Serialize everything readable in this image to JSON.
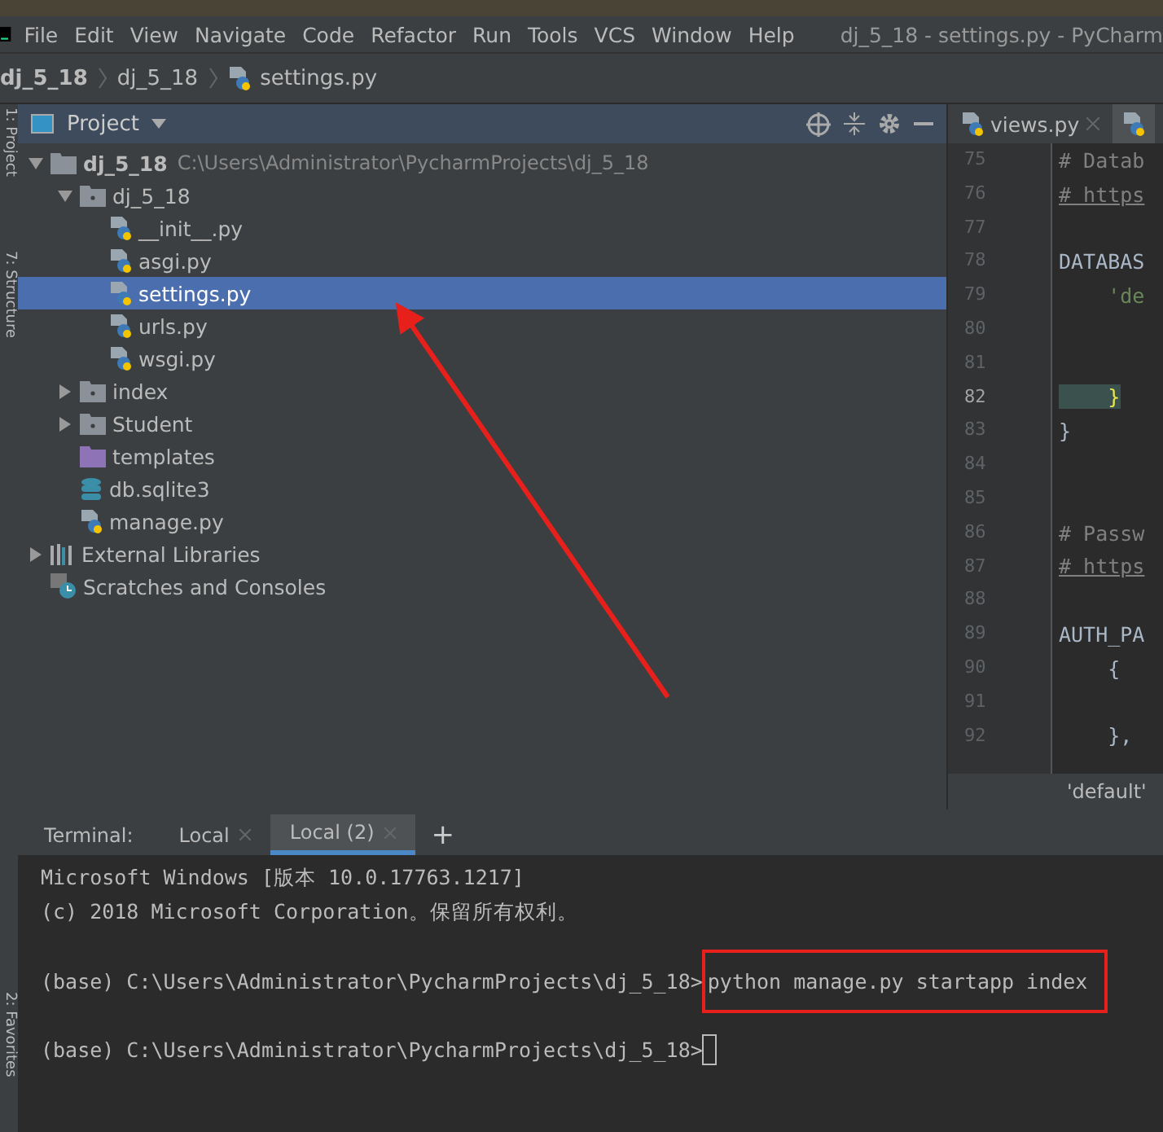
{
  "window": {
    "title": "dj_5_18 - settings.py - PyCharm"
  },
  "menu": [
    "File",
    "Edit",
    "View",
    "Navigate",
    "Code",
    "Refactor",
    "Run",
    "Tools",
    "VCS",
    "Window",
    "Help"
  ],
  "breadcrumbs": [
    "dj_5_18",
    "dj_5_18",
    "settings.py"
  ],
  "side_strip": [
    "1: Project",
    "7: Structure",
    "2: Favorites"
  ],
  "project_panel": {
    "title": "Project",
    "tree": [
      {
        "name": "dj_5_18",
        "kind": "root",
        "path": "C:\\Users\\Administrator\\PycharmProjects\\dj_5_18",
        "expanded": true,
        "selected": false,
        "children": [
          {
            "name": "dj_5_18",
            "kind": "package",
            "expanded": true,
            "selected": false,
            "children": [
              {
                "name": "__init__.py",
                "kind": "py",
                "selected": false
              },
              {
                "name": "asgi.py",
                "kind": "py",
                "selected": false
              },
              {
                "name": "settings.py",
                "kind": "py",
                "selected": true
              },
              {
                "name": "urls.py",
                "kind": "py",
                "selected": false
              },
              {
                "name": "wsgi.py",
                "kind": "py",
                "selected": false
              }
            ]
          },
          {
            "name": "index",
            "kind": "package",
            "expanded": false,
            "selected": false
          },
          {
            "name": "Student",
            "kind": "package",
            "expanded": false,
            "selected": false
          },
          {
            "name": "templates",
            "kind": "templates",
            "selected": false
          },
          {
            "name": "db.sqlite3",
            "kind": "db",
            "selected": false
          },
          {
            "name": "manage.py",
            "kind": "py",
            "selected": false
          }
        ]
      },
      {
        "name": "External Libraries",
        "kind": "libraries",
        "expanded": false,
        "selected": false
      },
      {
        "name": "Scratches and Consoles",
        "kind": "scratches",
        "selected": false
      }
    ]
  },
  "editor": {
    "tabs": [
      {
        "label": "views.py",
        "selected": false
      }
    ],
    "lines": [
      {
        "number": "75",
        "text": "# Datab",
        "kind": "comment"
      },
      {
        "number": "76",
        "text": "# https",
        "kind": "link"
      },
      {
        "number": "77",
        "kind": "plain"
      },
      {
        "number": "78",
        "text": "DATABAS",
        "kind": "plain"
      },
      {
        "number": "79",
        "text": "    'de",
        "kind": "string"
      },
      {
        "number": "80",
        "kind": "plain"
      },
      {
        "number": "81",
        "kind": "plain"
      },
      {
        "number": "82",
        "text": "    }",
        "kind": "brace"
      },
      {
        "number": "83",
        "text": "}",
        "kind": "plain"
      },
      {
        "number": "84",
        "kind": "plain"
      },
      {
        "number": "85",
        "kind": "plain"
      },
      {
        "number": "86",
        "text": "# Passw",
        "kind": "comment"
      },
      {
        "number": "87",
        "text": "# https",
        "kind": "link"
      },
      {
        "number": "88",
        "kind": "plain"
      },
      {
        "number": "89",
        "text": "AUTH_PA",
        "kind": "plain"
      },
      {
        "number": "90",
        "text": "    {",
        "kind": "plain"
      },
      {
        "number": "91",
        "kind": "plain"
      },
      {
        "number": "92",
        "text": "    },",
        "kind": "plain"
      }
    ],
    "status": "'default'"
  },
  "terminal": {
    "label": "Terminal:",
    "tabs": [
      {
        "label": "Local",
        "selected": false
      },
      {
        "label": "Local (2)",
        "selected": true
      }
    ],
    "add": "+",
    "lines": [
      {
        "kind": "output",
        "text": "Microsoft Windows [版本 10.0.17763.1217]"
      },
      {
        "kind": "output",
        "text": "(c) 2018 Microsoft Corporation。保留所有权利。"
      },
      {
        "kind": "prompt",
        "text": "(base) C:\\Users\\Administrator\\PycharmProjects\\dj_5_18>",
        "command": "python manage.py startapp index",
        "boxed": true
      },
      {
        "kind": "prompt",
        "text": "(base) C:\\Users\\Administrator\\PycharmProjects\\dj_5_18>",
        "cursor": true
      }
    ]
  }
}
